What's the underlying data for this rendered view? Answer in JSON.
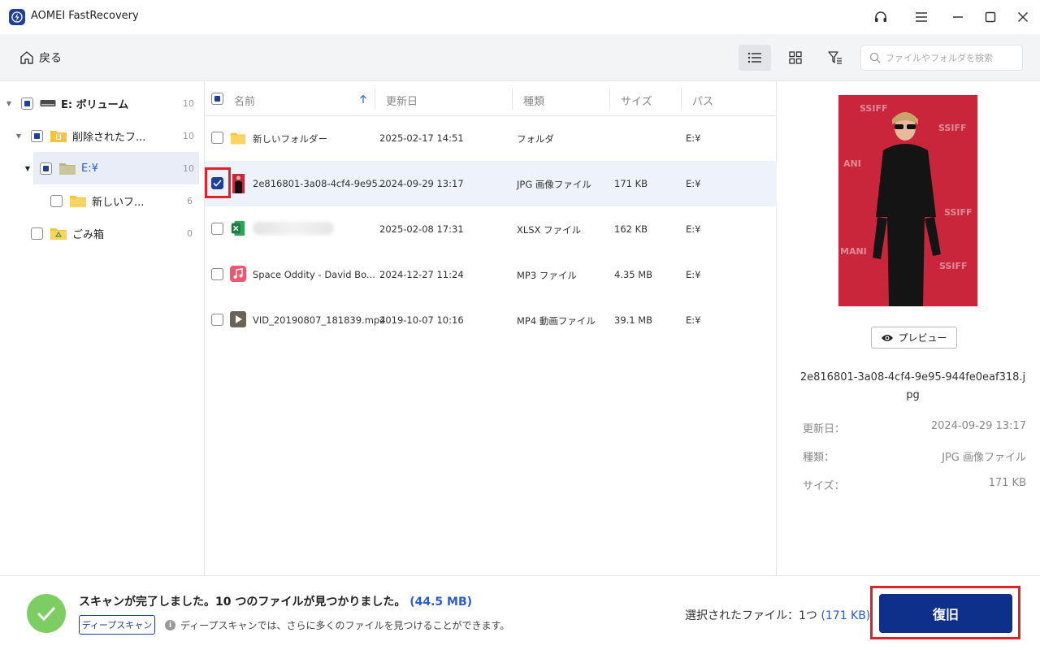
{
  "titlebar": {
    "app_title": "AOMEI FastRecovery"
  },
  "toolbar": {
    "back_label": "戻る",
    "search_placeholder": "ファイルやフォルダを検索"
  },
  "tree": {
    "items": [
      {
        "label": "E: ボリューム",
        "count": "10"
      },
      {
        "label": "削除されたフ...",
        "count": "10"
      },
      {
        "label": "E:¥",
        "count": "10"
      },
      {
        "label": "新しいフ...",
        "count": "6"
      },
      {
        "label": "ごみ箱",
        "count": "0"
      }
    ]
  },
  "list": {
    "columns": {
      "name": "名前",
      "modified": "更新日",
      "type": "種類",
      "size": "サイズ",
      "path": "パス"
    },
    "rows": [
      {
        "name": "新しいフォルダー",
        "modified": "2025-02-17 14:51",
        "type": "フォルダ",
        "size": "",
        "path": "E:¥"
      },
      {
        "name": "2e816801-3a08-4cf4-9e95...",
        "modified": "2024-09-29 13:17",
        "type": "JPG 画像ファイル",
        "size": "171 KB",
        "path": "E:¥"
      },
      {
        "name": "",
        "modified": "2025-02-08 17:31",
        "type": "XLSX ファイル",
        "size": "162 KB",
        "path": "E:¥"
      },
      {
        "name": "Space Oddity - David Bo...",
        "modified": "2024-12-27 11:24",
        "type": "MP3 ファイル",
        "size": "4.35 MB",
        "path": "E:¥"
      },
      {
        "name": "VID_20190807_181839.mp4",
        "modified": "2019-10-07 10:16",
        "type": "MP4 動画ファイル",
        "size": "39.1 MB",
        "path": "E:¥"
      }
    ]
  },
  "preview": {
    "button_label": "プレビュー",
    "file_name": "2e816801-3a08-4cf4-9e95-944fe0eaf318.jpg",
    "modified_label": "更新日：",
    "modified_value": "2024-09-29 13:17",
    "type_label": "種類：",
    "type_value": "JPG 画像ファイル",
    "size_label": "サイズ：",
    "size_value": "171 KB"
  },
  "bottom": {
    "scan_message": "スキャンが完了しました。10 つのファイルが見つかりました。",
    "scan_size": "(44.5 MB)",
    "deep_scan_label": "ディープスキャン",
    "deep_scan_note": "ディープスキャンでは、さらに多くのファイルを見つけることができます。",
    "selected_label": "選択されたファイル：1つ",
    "selected_size": "(171 KB)",
    "recover_label": "復旧"
  },
  "colors": {
    "accent": "#0e2f8a",
    "link": "#2a5bd7",
    "success": "#7ccd62",
    "highlight": "#e0232b"
  }
}
